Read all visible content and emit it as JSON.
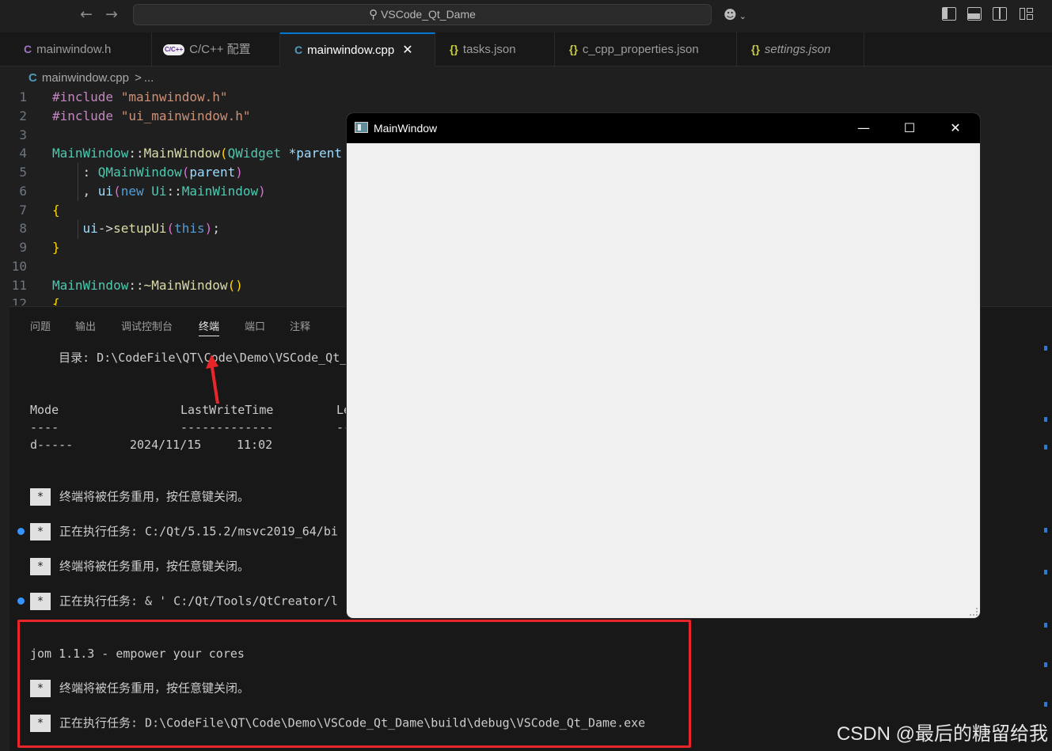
{
  "titlebar": {
    "back_icon": "arrow-left-icon",
    "forward_icon": "arrow-right-icon",
    "search_text": "VSCode_Qt_Dame",
    "copilot_icon": "copilot-icon"
  },
  "tabs": [
    {
      "icon": "C",
      "label": "mainwindow.h",
      "color": "#a074c4"
    },
    {
      "icon": "C/C++",
      "label": "C/C++ 配置",
      "color": "#b87bd6"
    },
    {
      "icon": "C",
      "label": "mainwindow.cpp",
      "color": "#519aba"
    },
    {
      "icon": "{}",
      "label": "tasks.json",
      "color": "#cbcb41"
    },
    {
      "icon": "{}",
      "label": "c_cpp_properties.json",
      "color": "#cbcb41"
    },
    {
      "icon": "{}",
      "label": "settings.json",
      "color": "#cbcb41"
    }
  ],
  "breadcrumb": {
    "file": "mainwindow.cpp",
    "separator": ">",
    "more": "..."
  },
  "editor": {
    "lines": [
      {
        "n": "1"
      },
      {
        "n": "2"
      },
      {
        "n": "3"
      },
      {
        "n": "4"
      },
      {
        "n": "5"
      },
      {
        "n": "6"
      },
      {
        "n": "7"
      },
      {
        "n": "8"
      },
      {
        "n": "9"
      },
      {
        "n": "10"
      },
      {
        "n": "11"
      },
      {
        "n": "12"
      }
    ],
    "code": {
      "inc1_kw": "#include",
      "inc1_str": "\"mainwindow.h\"",
      "inc2_kw": "#include",
      "inc2_str": "\"ui_mainwindow.h\"",
      "l4_cls": "MainWindow",
      "l4_sep": "::",
      "l4_fn": "MainWindow",
      "l4_paren": "(",
      "l4_type": "QWidget",
      "l4_rest": " *parent",
      "l5_colon": ": ",
      "l5_fn": "QMainWindow",
      "l5_p1": "(",
      "l5_var": "parent",
      "l5_p2": ")",
      "l6_comma": ", ",
      "l6_var": "ui",
      "l6_p1": "(",
      "l6_new": "new",
      "l6_cls": " Ui",
      "l6_sep": "::",
      "l6_cls2": "MainWindow",
      "l6_p2": ")",
      "l7_brace": "{",
      "l8_var": "ui",
      "l8_arrow": "->",
      "l8_fn": "setupUi",
      "l8_p1": "(",
      "l8_this": "this",
      "l8_p2": ")",
      "l8_semi": ";",
      "l9_brace": "}",
      "l11_cls": "MainWindow",
      "l11_sep": "::",
      "l11_fn": "~MainWindow",
      "l11_paren": "()",
      "l12_brace": "{"
    }
  },
  "panel": {
    "tabs": [
      "问题",
      "输出",
      "调试控制台",
      "终端",
      "端口",
      "注释"
    ],
    "active_tab": "终端",
    "terminal": {
      "dir_label": "    目录: D:\\CodeFile\\QT\\Code\\Demo\\VSCode_Qt_",
      "mode_header": "Mode",
      "lwt_header": "LastWriteTime",
      "len_header": "Le",
      "mode_dash": "----",
      "lwt_dash": "-------------",
      "len_dash": "--",
      "row_mode": "d-----",
      "row_date": "2024/11/15",
      "row_time": "11:02",
      "star": "*",
      "msg_reuse": "终端将被任务重用，按任意键关闭。",
      "msg_exec1": "正在执行任务: C:/Qt/5.15.2/msvc2019_64/bi",
      "msg_exec2": "正在执行任务: & ' C:/Qt/Tools/QtCreator/l",
      "jom": "jom 1.1.3 - empower your cores",
      "msg_exec3": "正在执行任务: D:\\CodeFile\\QT\\Code\\Demo\\VSCode_Qt_Dame\\build\\debug\\VSCode_Qt_Dame.exe"
    }
  },
  "qt_window": {
    "title": "MainWindow",
    "minimize": "—",
    "maximize": "☐",
    "close": "✕"
  },
  "watermark": "CSDN @最后的糖留给我",
  "colors": {
    "accent": "#0078d4",
    "annotation_red": "#e8262a",
    "dot_blue": "#3794ff"
  }
}
